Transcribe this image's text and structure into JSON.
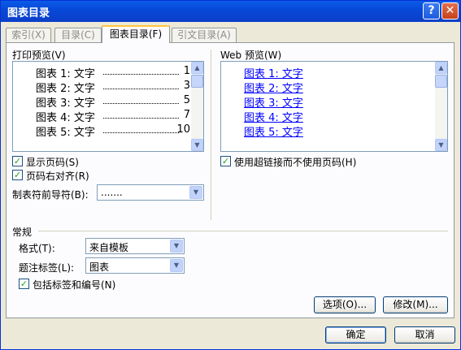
{
  "window": {
    "title": "图表目录",
    "help_glyph": "?",
    "close_glyph": "✕"
  },
  "tabs": [
    {
      "label": "索引(X)",
      "active": false
    },
    {
      "label": "目录(C)",
      "active": false
    },
    {
      "label": "图表目录(F)",
      "active": true
    },
    {
      "label": "引文目录(A)",
      "active": false
    }
  ],
  "print_preview": {
    "label": "打印预览(V)",
    "items": [
      {
        "name": "图表 1: 文字",
        "page": "1"
      },
      {
        "name": "图表 2: 文字",
        "page": "3"
      },
      {
        "name": "图表 3: 文字",
        "page": "5"
      },
      {
        "name": "图表 4: 文字",
        "page": "7"
      },
      {
        "name": "图表 5: 文字",
        "page": "10"
      }
    ]
  },
  "web_preview": {
    "label": "Web 预览(W)",
    "items": [
      "图表 1: 文字",
      "图表 2: 文字",
      "图表 3: 文字",
      "图表 4: 文字",
      "图表 5: 文字"
    ]
  },
  "options": {
    "show_page_numbers": {
      "label": "显示页码(S)",
      "checked": true
    },
    "right_align": {
      "label": "页码右对齐(R)",
      "checked": true
    },
    "tab_leader": {
      "label": "制表符前导符(B):",
      "value": "......."
    },
    "use_hyperlinks": {
      "label": "使用超链接而不使用页码(H)",
      "checked": true
    }
  },
  "general": {
    "heading": "常规",
    "format": {
      "label": "格式(T):",
      "value": "来自模板"
    },
    "caption_label": {
      "label": "题注标签(L):",
      "value": "图表"
    },
    "include_label": {
      "label": "包括标签和编号(N)",
      "checked": true
    }
  },
  "buttons": {
    "options": "选项(O)...",
    "modify": "修改(M)...",
    "ok": "确定",
    "cancel": "取消"
  },
  "icons": {
    "check": "✓",
    "scroll_up": "▲",
    "scroll_down": "▼",
    "dropdown": "▼"
  }
}
